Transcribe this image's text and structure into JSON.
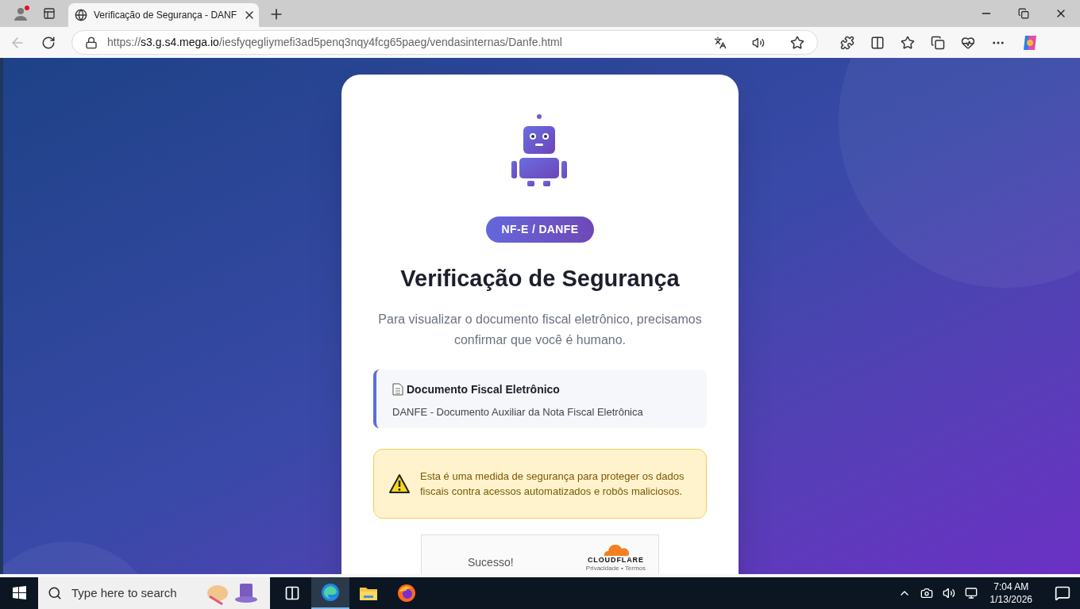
{
  "browser": {
    "tab": {
      "title": "Verificação de Segurança - DANF",
      "selected": true
    },
    "url": {
      "scheme": "https://",
      "host": "s3.g.s4.mega.io",
      "path": "/iesfyqegliymefi3ad5penq3nqy4fcg65paeg/vendasinternas/Danfe.html"
    }
  },
  "card": {
    "badge": "NF-E / DANFE",
    "title": "Verificação de Segurança",
    "subtitle": "Para visualizar o documento fiscal eletrônico, precisamos confirmar que você é humano.",
    "document": {
      "title": "Documento Fiscal Eletrônico",
      "description": "DANFE - Documento Auxiliar da Nota Fiscal Eletrônica"
    },
    "warning": "Esta é uma medida de segurança para proteger os dados fiscais contra acessos automatizados e robôs maliciosos.",
    "captcha": {
      "status": "Sucesso!",
      "brand": "CLOUDFLARE",
      "links": "Privacidade • Termos"
    }
  },
  "taskbar": {
    "search": {
      "placeholder": "Type here to search"
    },
    "apps": [
      {
        "kind": "taskview",
        "selected": false
      },
      {
        "kind": "edge",
        "selected": true
      },
      {
        "kind": "folder",
        "selected": false
      },
      {
        "kind": "firefox",
        "selected": false
      }
    ],
    "time": "7:04 AM",
    "date": "1/13/2026"
  }
}
